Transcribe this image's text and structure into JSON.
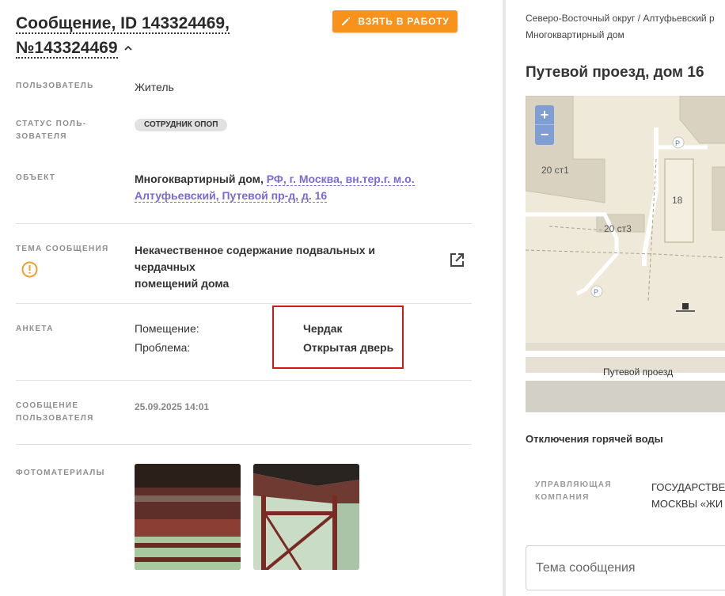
{
  "message": {
    "title_line1": "Сообщение, ID 143324469,",
    "title_line2": "№143324469",
    "take_button": "ВЗЯТЬ В РАБОТУ"
  },
  "fields": {
    "user_label": "ПОЛЬЗОВАТЕЛЬ",
    "user_value": "Житель",
    "status_label_1": "СТАТУС ПОЛЬ-",
    "status_label_2": "ЗОВАТЕЛЯ",
    "status_value": "СОТРУДНИК ОПОП",
    "object_label": "ОБЪЕКТ",
    "object_type": "Многоквартирный дом,",
    "object_address_1": "РФ, г. Москва, вн.тер.г. м.о.",
    "object_address_2": "Алтуфьевский, Путевой пр-д, д. 16",
    "topic_label": "ТЕМА СООБЩЕНИЯ",
    "topic_value_1": "Некачественное содержание подвальных и чердачных",
    "topic_value_2": "помещений дома",
    "survey_label": "АНКЕТА",
    "survey_q1": "Помещение:",
    "survey_a1": "Чердак",
    "survey_q2": "Проблема:",
    "survey_a2": "Открытая дверь",
    "user_msg_label_1": "СООБЩЕНИЕ",
    "user_msg_label_2": "ПОЛЬЗОВАТЕЛЯ",
    "user_msg_date": "25.09.2025 14:01",
    "photos_label": "ФОТОМАТЕРИАЛЫ"
  },
  "right": {
    "breadcrumb_1": "Северо-Восточный округ / Алтуфьевский р",
    "breadcrumb_2": "Многоквартирный дом",
    "address": "Путевой проезд, дом 16",
    "map": {
      "zoom_in": "+",
      "zoom_out": "−",
      "label_20st1": "20 ст1",
      "label_20st3": "20 ст3",
      "label_18": "18",
      "label_street": "Путевой проезд",
      "parking": "P"
    },
    "outage_title": "Отключения горячей воды",
    "mgmt_label_1": "УПРАВЛЯЮЩАЯ",
    "mgmt_label_2": "КОМПАНИЯ",
    "mgmt_value_1": "ГОСУДАРСТВЕ",
    "mgmt_value_2": "МОСКВЫ «ЖИ",
    "topic_placeholder": "Тема сообщения"
  },
  "colors": {
    "accent_orange": "#f7931d",
    "link_purple": "#7b6ad6",
    "highlight_red": "#d01a1a",
    "warning_orange": "#f0a030",
    "map_bg": "#efe9da"
  }
}
